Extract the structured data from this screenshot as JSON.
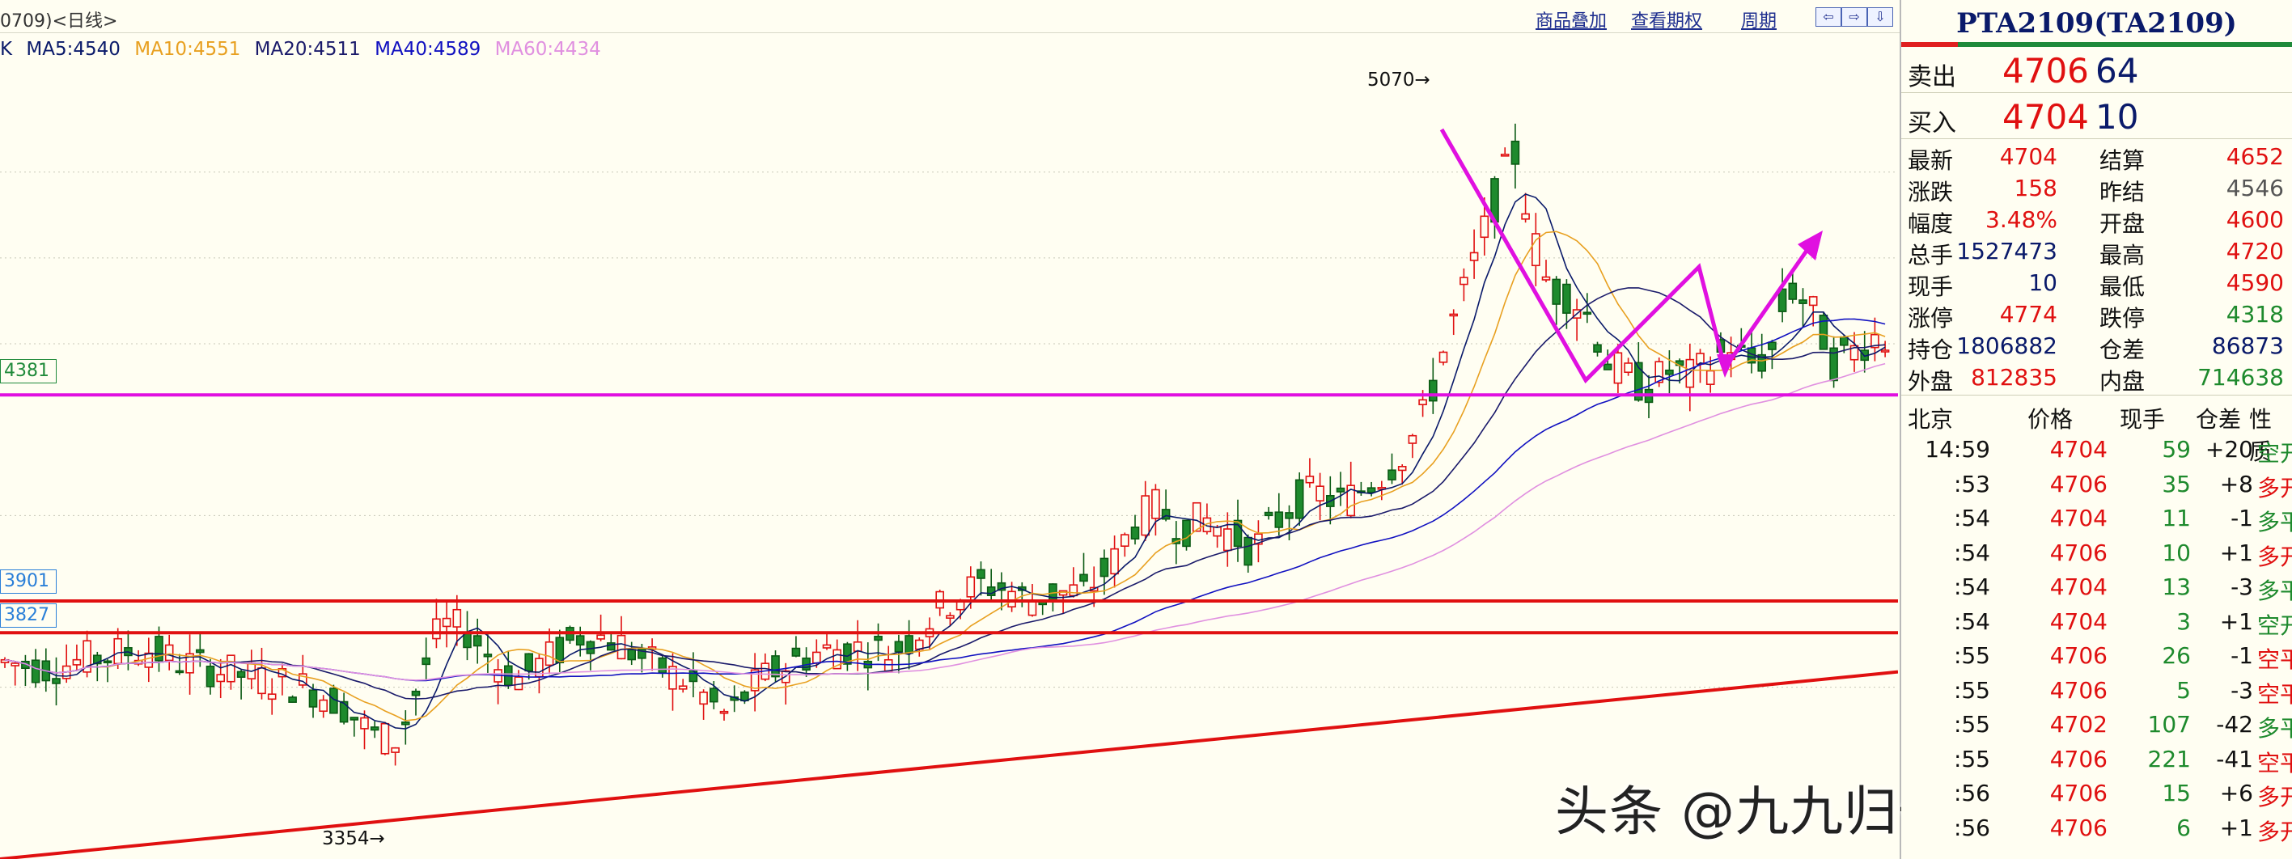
{
  "top_bar": {
    "title": "0709)<日线>",
    "links": [
      "商品叠加",
      "查看期权",
      "周期"
    ],
    "nav_buttons": [
      "⇦",
      "⇨",
      "⇩"
    ]
  },
  "ma_legend": [
    {
      "text": "K",
      "color": "#0a1a6a"
    },
    {
      "text": "MA5:4540",
      "color": "#0a1a6a"
    },
    {
      "text": "MA10:4551",
      "color": "#e8a020"
    },
    {
      "text": "MA20:4511",
      "color": "#1a1a6a"
    },
    {
      "text": "MA40:4589",
      "color": "#1010c0"
    },
    {
      "text": "MA60:4434",
      "color": "#e090e0"
    }
  ],
  "price_chart": {
    "y_range": [
      3300,
      5150
    ],
    "high_label": "5070",
    "low_label": "3354",
    "levels": [
      {
        "label": "4381",
        "value": 4381,
        "color": "#e010e0",
        "text_color": "#1f8a3a"
      },
      {
        "label": "3901",
        "value": 3901,
        "color": "#e01010",
        "text_color": "#2a7fd8"
      },
      {
        "label": "3827",
        "value": 3827,
        "color": "#e01010",
        "text_color": "#2a7fd8"
      }
    ]
  },
  "watermark": "头条 @九九归一期货徐子淇",
  "quote": {
    "symbol": "PTA2109(TA2109)",
    "sell": {
      "label": "卖出",
      "price": "4706",
      "vol": "64"
    },
    "buy": {
      "label": "买入",
      "price": "4704",
      "vol": "10"
    },
    "stats": [
      {
        "l1": "最新",
        "v1": "4704",
        "c1": "red",
        "l2": "结算",
        "v2": "4652",
        "c2": "red"
      },
      {
        "l1": "涨跌",
        "v1": "158",
        "c1": "red",
        "l2": "昨结",
        "v2": "4546",
        "c2": "gray"
      },
      {
        "l1": "幅度",
        "v1": "3.48%",
        "c1": "red",
        "l2": "开盘",
        "v2": "4600",
        "c2": "red"
      },
      {
        "l1": "总手",
        "v1": "1527473",
        "c1": "navy",
        "l2": "最高",
        "v2": "4720",
        "c2": "red"
      },
      {
        "l1": "现手",
        "v1": "10",
        "c1": "navy",
        "l2": "最低",
        "v2": "4590",
        "c2": "red"
      },
      {
        "l1": "涨停",
        "v1": "4774",
        "c1": "red",
        "l2": "跌停",
        "v2": "4318",
        "c2": "green"
      },
      {
        "l1": "持仓",
        "v1": "1806882",
        "c1": "navy",
        "l2": "仓差",
        "v2": "86873",
        "c2": "navy"
      },
      {
        "l1": "外盘",
        "v1": "812835",
        "c1": "red",
        "l2": "内盘",
        "v2": "714638",
        "c2": "green"
      }
    ],
    "tick_header": [
      "北京",
      "价格",
      "现手",
      "仓差",
      "性质"
    ],
    "ticks": [
      {
        "time": "14:59",
        "price": "4704",
        "vol": "59",
        "oi": "+20",
        "type": "空开",
        "type_color": "green"
      },
      {
        "time": ":53",
        "price": "4706",
        "vol": "35",
        "oi": "+8",
        "type": "多开",
        "type_color": "red"
      },
      {
        "time": ":54",
        "price": "4704",
        "vol": "11",
        "oi": "-1",
        "type": "多平",
        "type_color": "green"
      },
      {
        "time": ":54",
        "price": "4706",
        "vol": "10",
        "oi": "+1",
        "type": "多开",
        "type_color": "red"
      },
      {
        "time": ":54",
        "price": "4704",
        "vol": "13",
        "oi": "-3",
        "type": "多平",
        "type_color": "green"
      },
      {
        "time": ":54",
        "price": "4704",
        "vol": "3",
        "oi": "+1",
        "type": "空开",
        "type_color": "green"
      },
      {
        "time": ":55",
        "price": "4706",
        "vol": "26",
        "oi": "-1",
        "type": "空平",
        "type_color": "red"
      },
      {
        "time": ":55",
        "price": "4706",
        "vol": "5",
        "oi": "-3",
        "type": "空平",
        "type_color": "red"
      },
      {
        "time": ":55",
        "price": "4702",
        "vol": "107",
        "oi": "-42",
        "type": "多平",
        "type_color": "green"
      },
      {
        "time": ":55",
        "price": "4706",
        "vol": "221",
        "oi": "-41",
        "type": "空平",
        "type_color": "red"
      },
      {
        "time": ":56",
        "price": "4706",
        "vol": "15",
        "oi": "+6",
        "type": "多开",
        "type_color": "red"
      },
      {
        "time": ":56",
        "price": "4706",
        "vol": "6",
        "oi": "+1",
        "type": "多开",
        "type_color": "red"
      }
    ]
  }
}
